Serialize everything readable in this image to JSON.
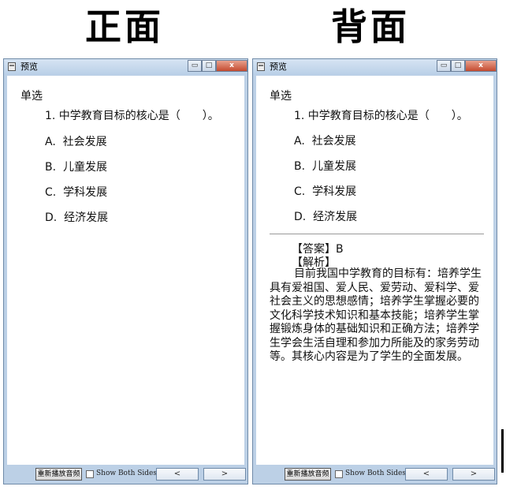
{
  "headings": {
    "front": "正面",
    "back": "背面"
  },
  "window": {
    "title": "预览",
    "controls": {
      "minimize": "▭",
      "maximize": "□",
      "close": "x"
    }
  },
  "question": {
    "type": "单选",
    "stem": "1. 中学教育目标的核心是（　　）。",
    "options": [
      "A.  社会发展",
      "B.  儿童发展",
      "C.  学科发展",
      "D.  经济发展"
    ]
  },
  "answer": {
    "answer_label": "【答案】B",
    "explanation_label": "【解析】",
    "explanation": "目前我国中学教育的目标有：培养学生具有爱祖国、爱人民、爱劳动、爱科学、爱社会主义的思想感情；培养学生掌握必要的文化科学技术知识和基本技能；培养学生掌握锻炼身体的基础知识和正确方法；培养学生学会生活自理和参加力所能及的家务劳动等。其核心内容是为了学生的全面发展。"
  },
  "footer": {
    "replay_label": "重新播放音频",
    "show_both_label": "Show Both Sides",
    "show_both_checked": false,
    "prev_label": "<",
    "next_label": ">"
  }
}
